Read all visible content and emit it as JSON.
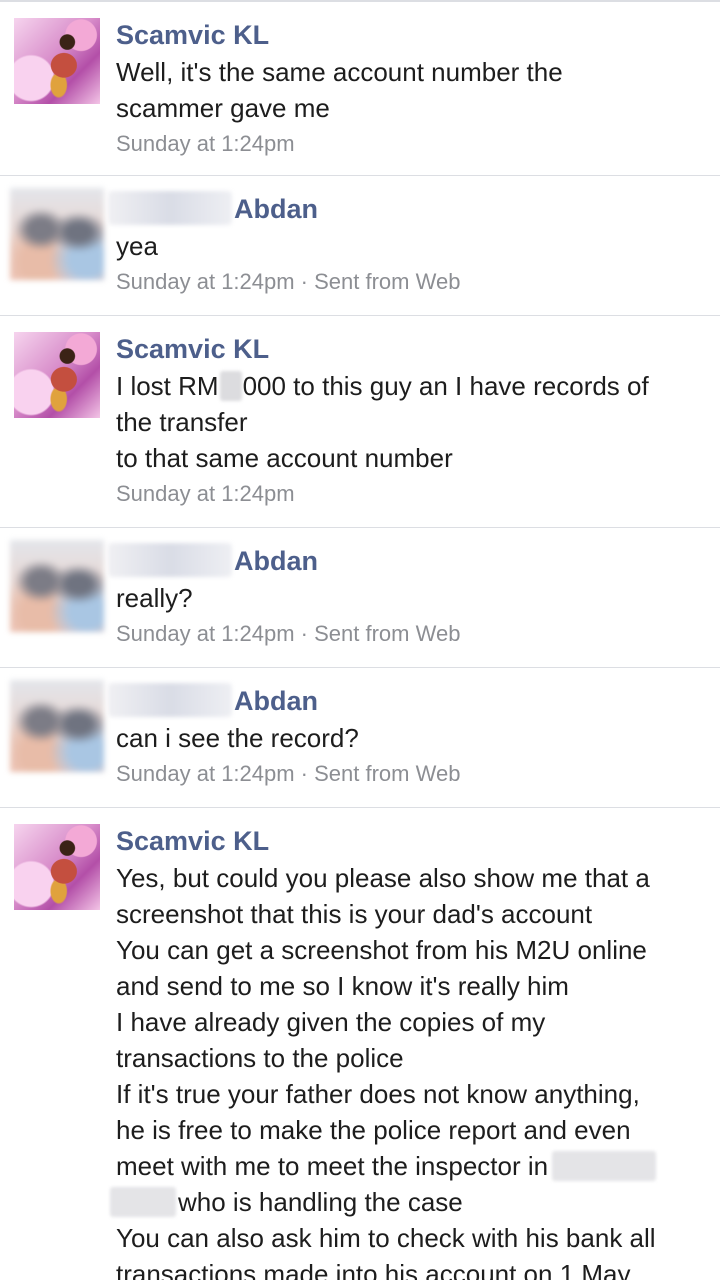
{
  "messages": [
    {
      "sender": "Scamvic KL",
      "lines": [
        "Well, it's the same account number the",
        "scammer gave me"
      ],
      "time": "Sunday at 1:24pm"
    },
    {
      "sender": "Abdan",
      "lines": [
        "yea"
      ],
      "time": "Sunday at 1:24pm · Sent from Web"
    },
    {
      "sender": "Scamvic KL",
      "line1_a": "I lost RM",
      "line1_b": "000 to this guy an I have records of",
      "lines": [
        "the transfer",
        "to that same account number"
      ],
      "time": "Sunday at 1:24pm"
    },
    {
      "sender": "Abdan",
      "lines": [
        "really?"
      ],
      "time": "Sunday at 1:24pm · Sent from Web"
    },
    {
      "sender": "Abdan",
      "lines": [
        "can i see the record?"
      ],
      "time": "Sunday at 1:24pm · Sent from Web"
    },
    {
      "sender": "Scamvic KL",
      "lines": [
        "Yes, but could you please also show me that a",
        "screenshot that this is your dad's account",
        "You can get a screenshot from his M2U online",
        "and send to me so I know it's really him",
        "I have already given the copies of my",
        "transactions to the police",
        "If it's true your father does not know anything,",
        "he is free to make the police report and even",
        "meet with me to meet the inspector in",
        "who is handling the case",
        "You can also ask him to check with his bank all",
        "transactions made into his account on 1 May"
      ]
    }
  ]
}
